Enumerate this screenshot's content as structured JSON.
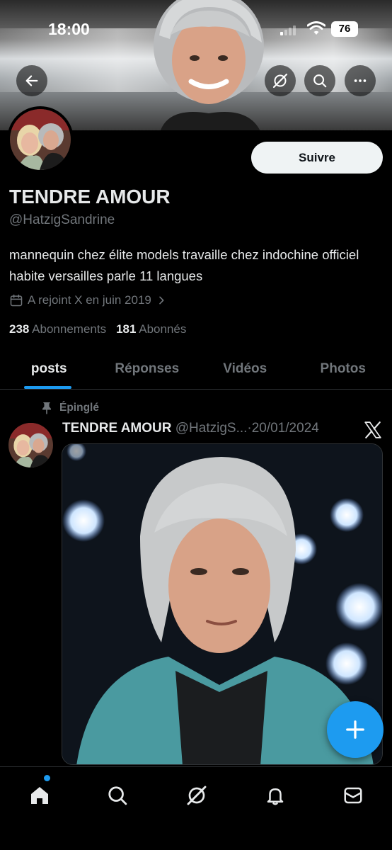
{
  "status_bar": {
    "time": "18:00",
    "battery": "76"
  },
  "profile": {
    "name": "TENDRE AMOUR",
    "handle": "@HatzigSandrine",
    "bio": "mannequin chez élite models travaille chez indochine officiel habite versailles parle 11 langues",
    "joined": "A rejoint X en juin 2019",
    "following_count": "238",
    "following_label": "Abonnements",
    "followers_count": "181",
    "followers_label": "Abonnés",
    "follow_label": "Suivre"
  },
  "tabs": [
    {
      "label": "posts",
      "active": true
    },
    {
      "label": "Réponses",
      "active": false
    },
    {
      "label": "Vidéos",
      "active": false
    },
    {
      "label": "Photos",
      "active": false
    }
  ],
  "post": {
    "pinned_label": "Épinglé",
    "author_name": "TENDRE AMOUR",
    "author_handle": "@HatzigS...",
    "separator": "·",
    "date": "20/01/2024"
  },
  "icons": {
    "back": "arrow-left-icon",
    "grok": "grok-icon",
    "search": "search-icon",
    "more": "more-icon",
    "calendar": "calendar-icon",
    "chevron": "chevron-right-icon",
    "pin": "pin-icon",
    "x_logo": "x-logo-icon",
    "compose": "plus-icon",
    "nav": [
      "home-icon",
      "search-icon",
      "grok-icon",
      "bell-icon",
      "mail-icon"
    ]
  },
  "colors": {
    "accent": "#1d9bf0",
    "background": "#000000",
    "muted": "#71767b",
    "text": "#e7e9ea"
  }
}
